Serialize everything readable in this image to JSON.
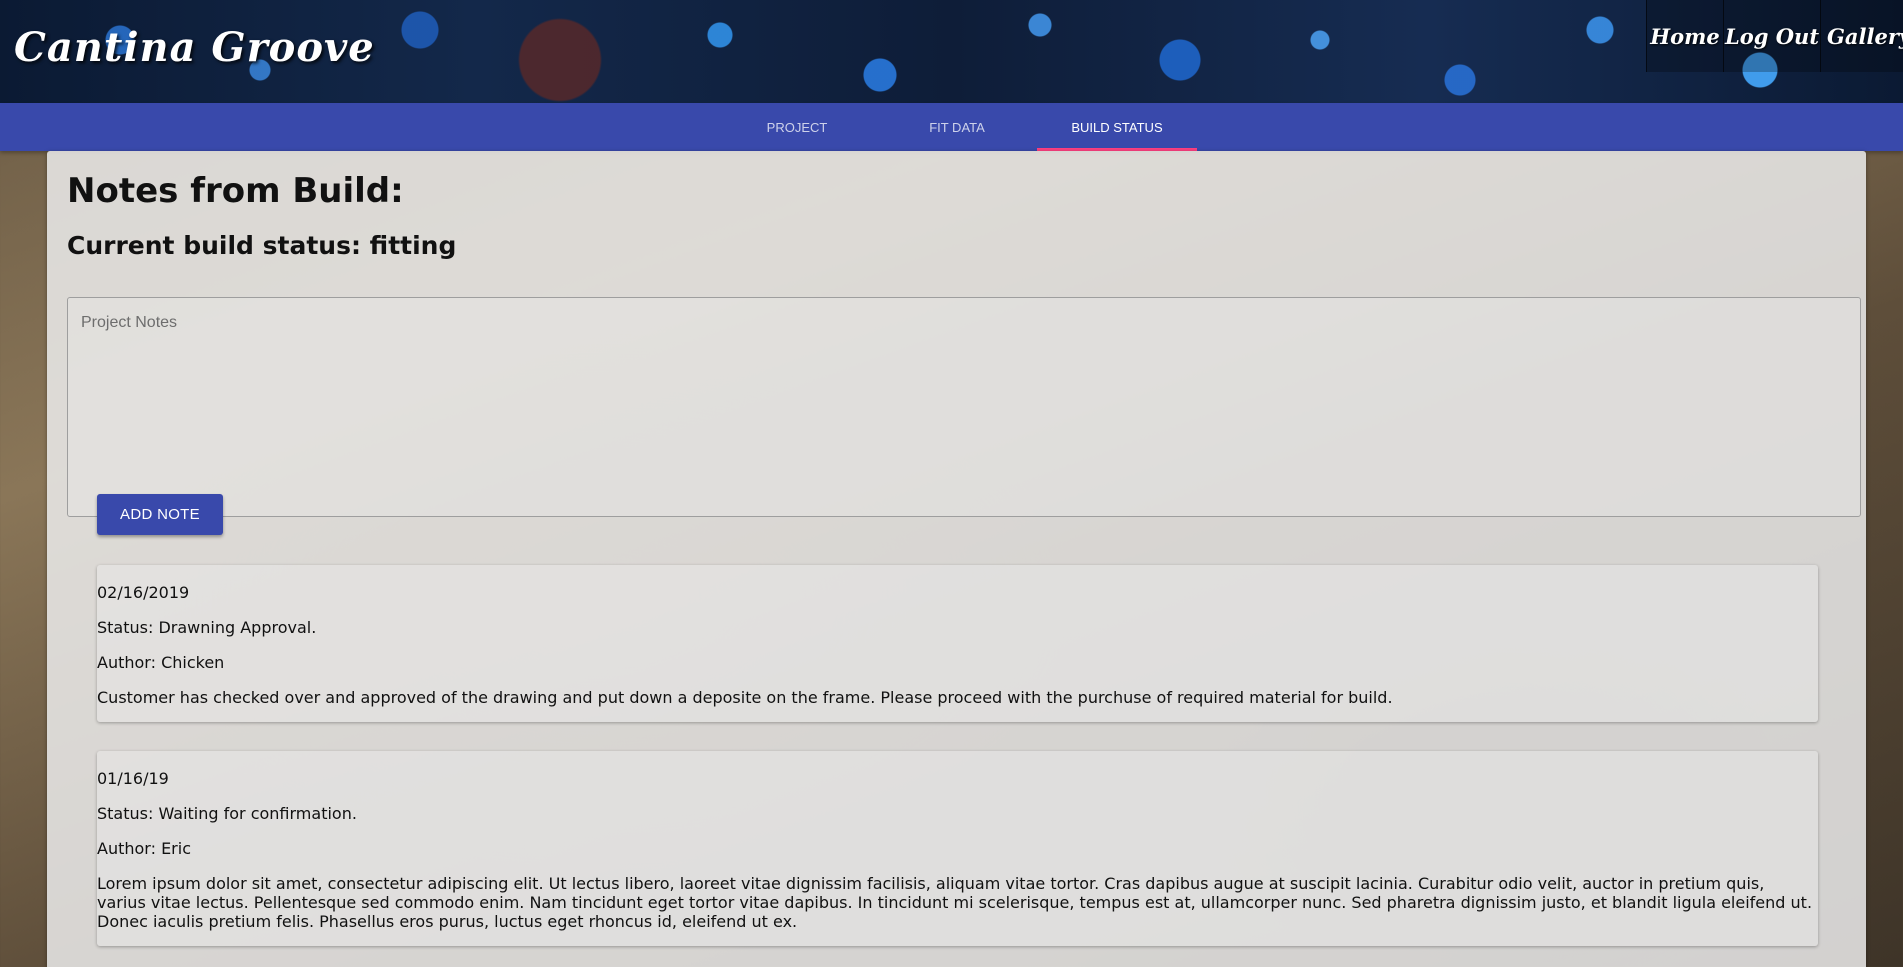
{
  "header": {
    "brand": "Cantina Groove",
    "nav": [
      {
        "label": "Home"
      },
      {
        "label": "Log Out"
      },
      {
        "label": "Gallery"
      }
    ]
  },
  "tabs": [
    {
      "label": "PROJECT",
      "active": false
    },
    {
      "label": "FIT DATA",
      "active": false
    },
    {
      "label": "BUILD STATUS",
      "active": true
    }
  ],
  "main": {
    "title": "Notes from Build:",
    "status_heading": "Current build status: fitting",
    "notes_placeholder": "Project Notes",
    "notes_value": "",
    "add_button": "ADD NOTE",
    "notes": [
      {
        "date": "02/16/2019",
        "status": "Status: Drawning Approval.",
        "author": "Author: Chicken",
        "body": "Customer has checked over and approved of the drawing and put down a deposite on the frame. Please proceed with the purchuse of required material for build."
      },
      {
        "date": "01/16/19",
        "status": "Status: Waiting for confirmation.",
        "author": "Author: Eric",
        "body": "Lorem ipsum dolor sit amet, consectetur adipiscing elit. Ut lectus libero, laoreet vitae dignissim facilisis, aliquam vitae tortor. Cras dapibus augue at suscipit lacinia. Curabitur odio velit, auctor in pretium quis, varius vitae lectus. Pellentesque sed commodo enim. Nam tincidunt eget tortor vitae dapibus. In tincidunt mi scelerisque, tempus est at, ullamcorper nunc. Sed pharetra dignissim justo, et blandit ligula eleifend ut. Donec iaculis pretium felis. Phasellus eros purus, luctus eget rhoncus id, eleifend ut ex."
      }
    ]
  },
  "colors": {
    "primary": "#3949ab",
    "tab_indicator": "#ff4081"
  }
}
